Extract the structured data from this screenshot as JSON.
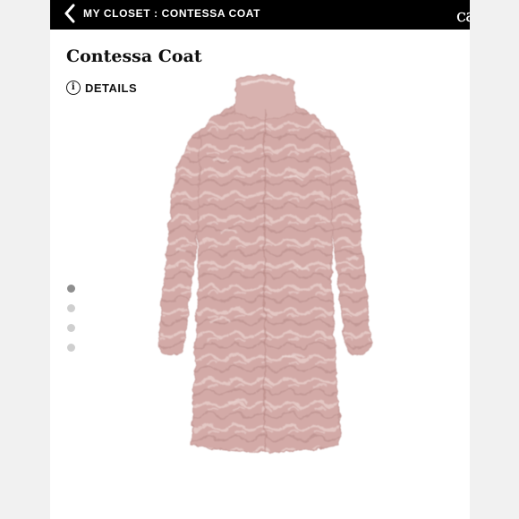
{
  "header": {
    "breadcrumb": "MY CLOSET : CONTESSA COAT",
    "brand_text": "ca",
    "back_icon": "chevron-left-icon"
  },
  "product": {
    "title": "Contessa Coat",
    "details_label": "DETAILS",
    "details_icon": "info-icon"
  },
  "gallery": {
    "image_count": 4,
    "active_index": 0
  },
  "colors": {
    "header_bg": "#000000",
    "coat_pink": "#d2a9a6",
    "dot_active": "#8e8e8e",
    "dot_inactive": "#cfcfcf"
  }
}
